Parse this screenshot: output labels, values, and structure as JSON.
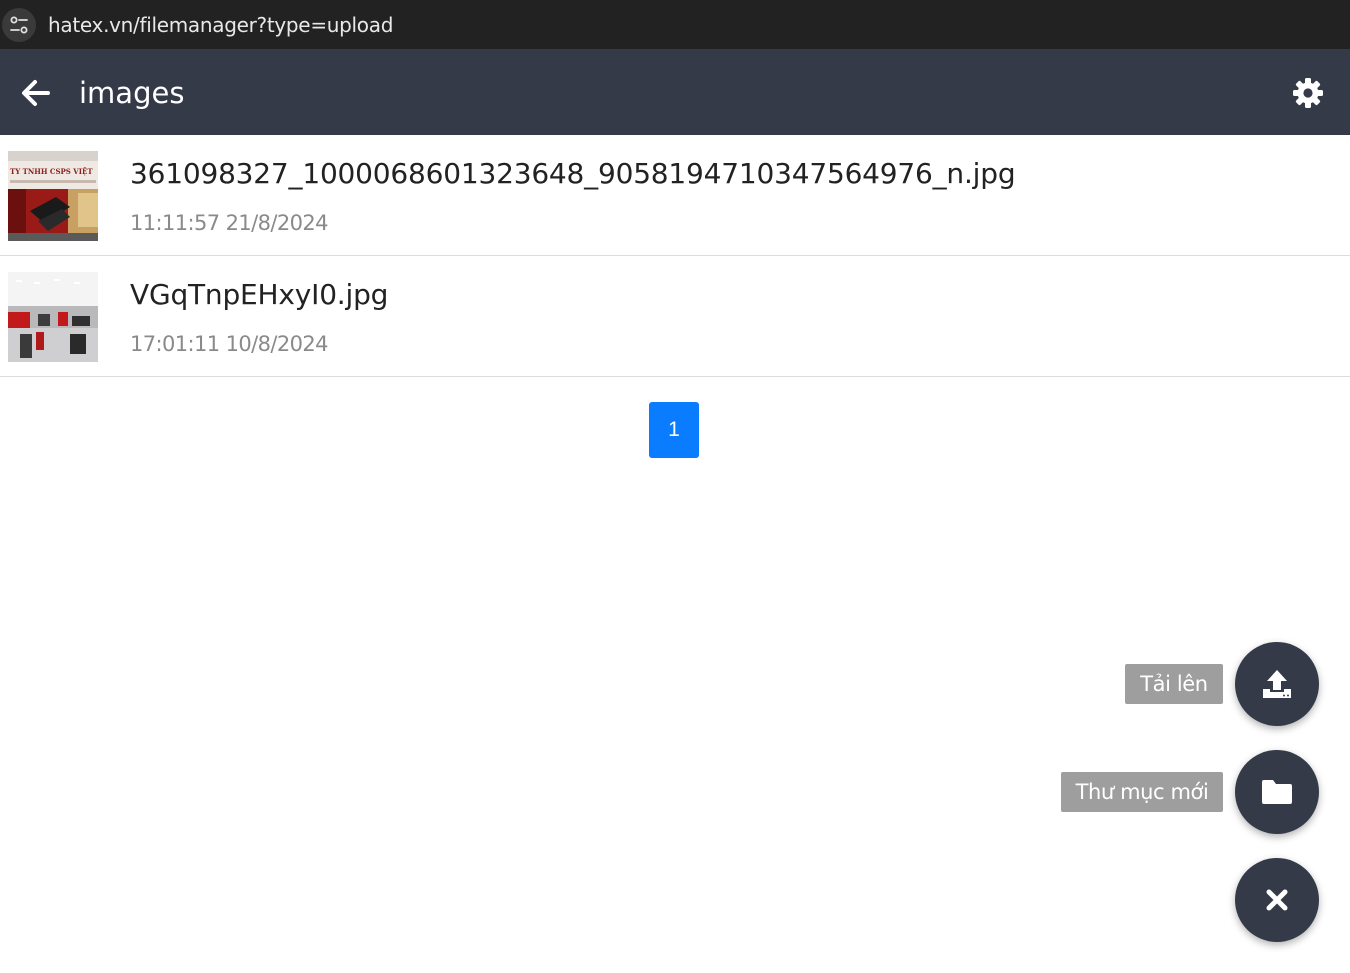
{
  "browser": {
    "url": "hatex.vn/filemanager?type=upload",
    "site_info_icon": "tune-icon"
  },
  "header": {
    "back_icon": "arrow-left-icon",
    "title": "images",
    "settings_icon": "gear-icon"
  },
  "files": [
    {
      "name": "361098327_1000068601323648_9058194710347564976_n.jpg",
      "modified": "11:11:57 21/8/2024",
      "thumb_text": "TY TNHH CSPS VIỆT"
    },
    {
      "name": "VGqTnpEHxyI0.jpg",
      "modified": "17:01:11 10/8/2024"
    }
  ],
  "pagination": {
    "current_page": "1",
    "active_color": "#0a7cff"
  },
  "fab_menu": {
    "upload_label": "Tải lên",
    "upload_icon": "upload-icon",
    "new_folder_label": "Thư mục mới",
    "new_folder_icon": "folder-icon",
    "close_icon": "close-icon"
  },
  "colors": {
    "header_bg": "#343a48",
    "fab_bg": "#343a48",
    "label_bg": "#9e9e9e"
  }
}
